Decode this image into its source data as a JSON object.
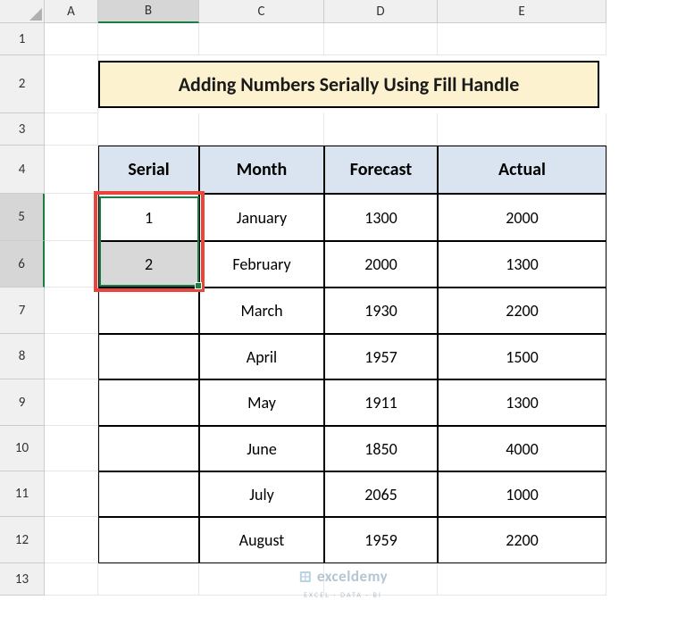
{
  "columns": [
    "A",
    "B",
    "C",
    "D",
    "E"
  ],
  "rows": [
    "1",
    "2",
    "3",
    "4",
    "5",
    "6",
    "7",
    "8",
    "9",
    "10",
    "11",
    "12",
    "13"
  ],
  "title": "Adding Numbers Serially Using Fill Handle",
  "headers": {
    "serial": "Serial",
    "month": "Month",
    "forecast": "Forecast",
    "actual": "Actual"
  },
  "data": [
    {
      "serial": "1",
      "month": "January",
      "forecast": "1300",
      "actual": "2000"
    },
    {
      "serial": "2",
      "month": "February",
      "forecast": "2000",
      "actual": "1300"
    },
    {
      "serial": "",
      "month": "March",
      "forecast": "1930",
      "actual": "2200"
    },
    {
      "serial": "",
      "month": "April",
      "forecast": "1957",
      "actual": "1500"
    },
    {
      "serial": "",
      "month": "May",
      "forecast": "1911",
      "actual": "1300"
    },
    {
      "serial": "",
      "month": "June",
      "forecast": "1850",
      "actual": "4000"
    },
    {
      "serial": "",
      "month": "July",
      "forecast": "2065",
      "actual": "1000"
    },
    {
      "serial": "",
      "month": "August",
      "forecast": "1959",
      "actual": "2200"
    }
  ],
  "watermark": {
    "name": "exceldemy",
    "tag": "EXCEL · DATA · BI"
  },
  "chart_data": {
    "type": "table",
    "title": "Adding Numbers Serially Using Fill Handle",
    "columns": [
      "Serial",
      "Month",
      "Forecast",
      "Actual"
    ],
    "rows": [
      [
        1,
        "January",
        1300,
        2000
      ],
      [
        2,
        "February",
        2000,
        1300
      ],
      [
        null,
        "March",
        1930,
        2200
      ],
      [
        null,
        "April",
        1957,
        1500
      ],
      [
        null,
        "May",
        1911,
        1300
      ],
      [
        null,
        "June",
        1850,
        4000
      ],
      [
        null,
        "July",
        2065,
        1000
      ],
      [
        null,
        "August",
        1959,
        2200
      ]
    ]
  }
}
